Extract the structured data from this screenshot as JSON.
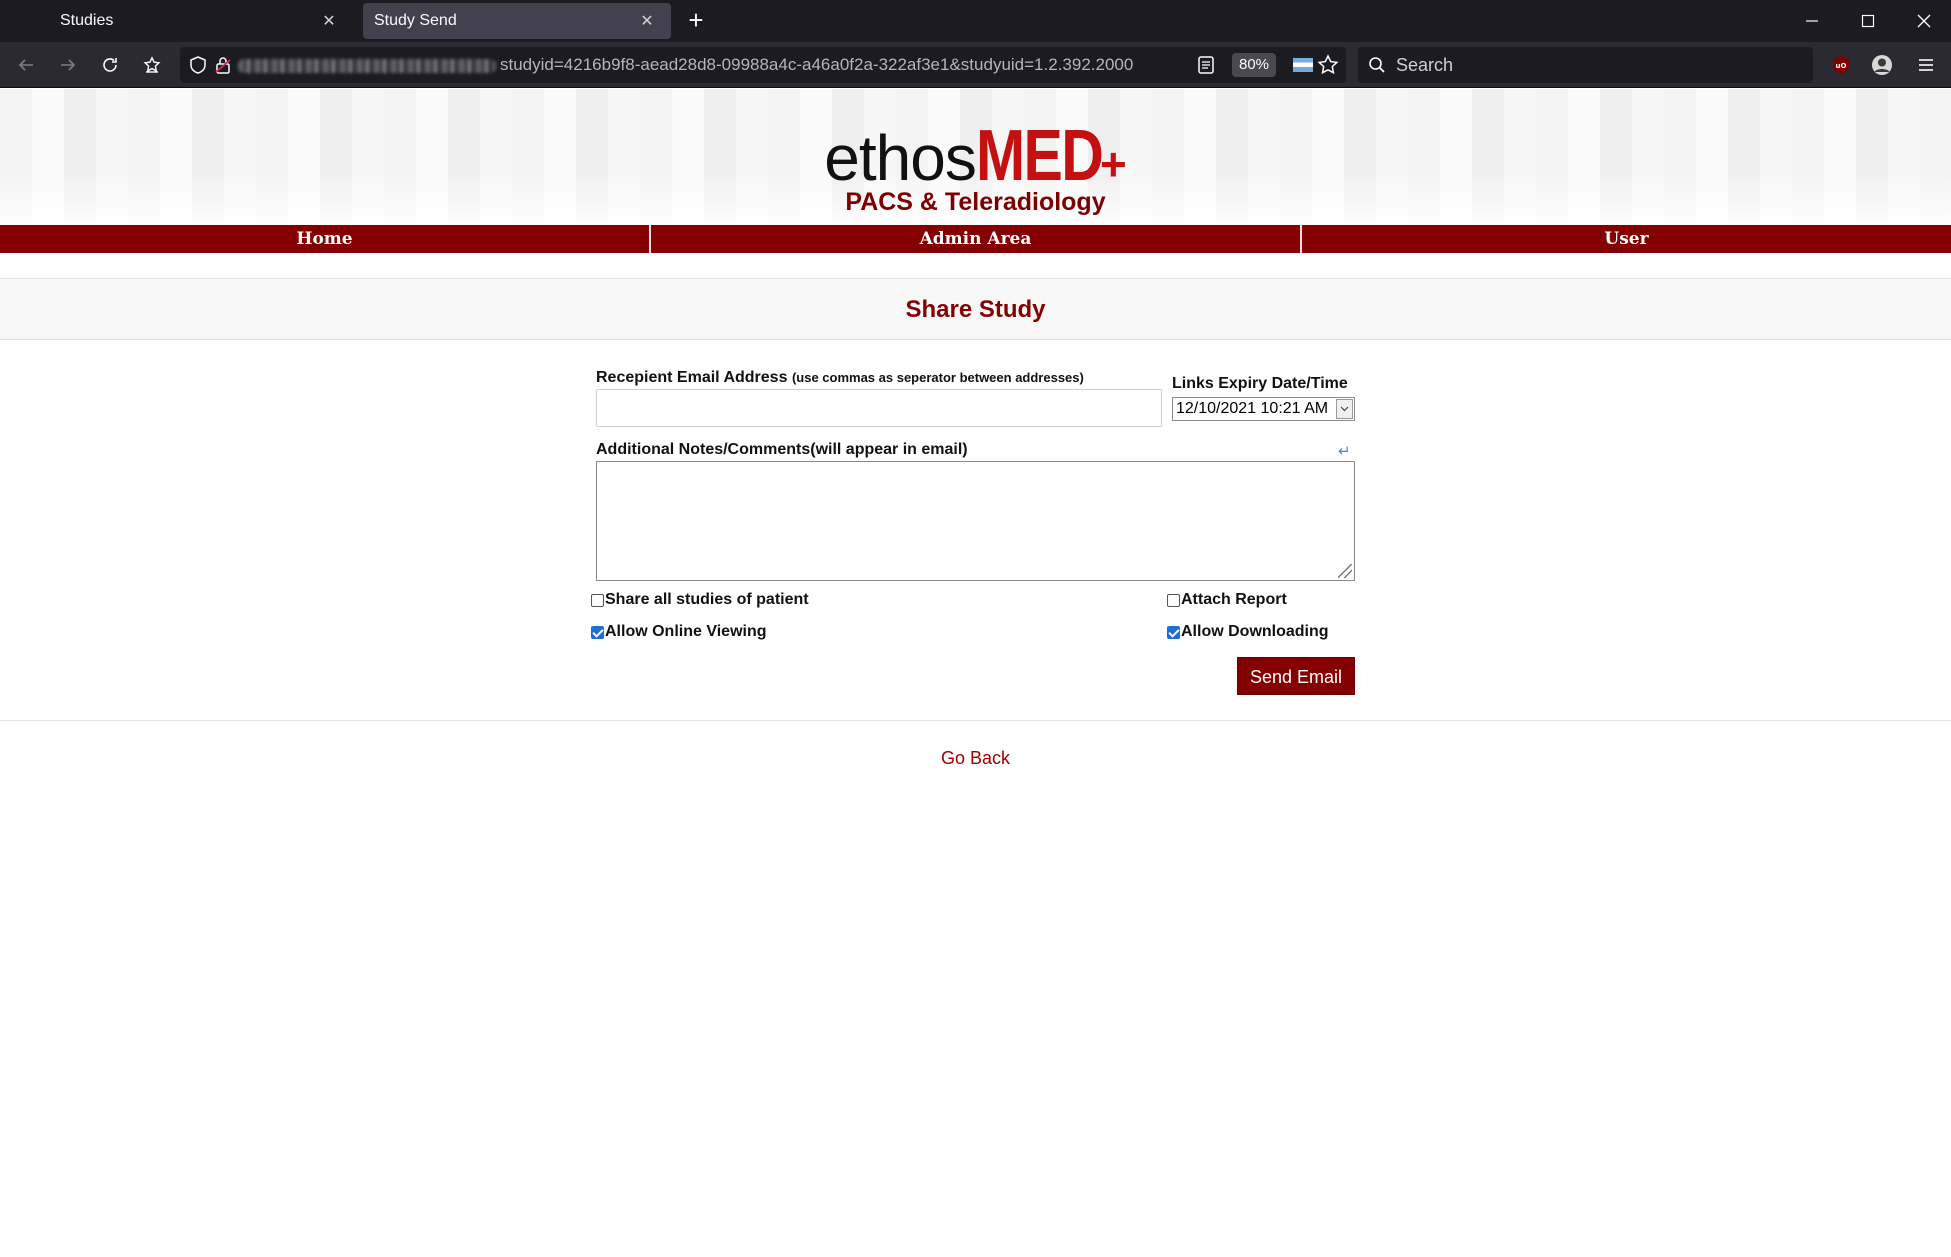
{
  "browser": {
    "tabs": [
      {
        "label": "Studies",
        "active": false
      },
      {
        "label": "Study Send",
        "active": true
      }
    ],
    "url_visible": "studyid=4216b9f8-aead28d8-09988a4c-a46a0f2a-322af3e1&studyuid=1.2.392.2000",
    "zoom": "80%",
    "search_placeholder": "Search",
    "icons": [
      "back-icon",
      "forward-icon",
      "reload-icon",
      "pocket-icon",
      "shield-icon",
      "lock-icon",
      "reader-view-icon",
      "flag-icon",
      "bookmark-star-icon",
      "search-icon",
      "ublock-icon",
      "profile-icon",
      "menu-icon"
    ]
  },
  "site": {
    "logo_ethos": "ethos",
    "logo_med": "MED",
    "logo_plus": "+",
    "tagline": "PACS & Teleradiology",
    "brand_color": "#850000",
    "menu": [
      "Home",
      "Admin Area",
      "User"
    ]
  },
  "form": {
    "title": "Share Study",
    "email_label": "Recepient Email Address",
    "email_hint": "(use commas as seperator between addresses)",
    "email_value": "",
    "expiry_label": "Links Expiry Date/Time",
    "expiry_value": "12/10/2021 10:21 AM",
    "notes_label": "Additional Notes/Comments(will appear in email)",
    "notes_value": "",
    "checkboxes": {
      "share_all": {
        "label": "Share all studies of patient",
        "checked": false
      },
      "attach_report": {
        "label": "Attach Report",
        "checked": false
      },
      "online_viewing": {
        "label": "Allow Online Viewing",
        "checked": true
      },
      "downloading": {
        "label": "Allow Downloading",
        "checked": true
      }
    },
    "send_label": "Send Email",
    "go_back_label": "Go Back"
  }
}
